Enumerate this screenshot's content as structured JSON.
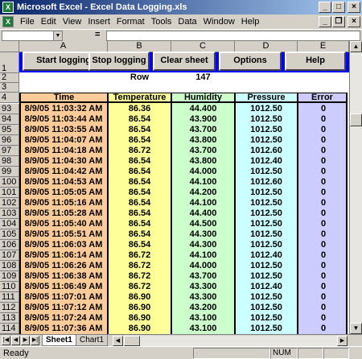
{
  "window": {
    "title": "Microsoft Excel - Excel Data Logging.xls",
    "app_icon": "X"
  },
  "menu": [
    "File",
    "Edit",
    "View",
    "Insert",
    "Format",
    "Tools",
    "Data",
    "Window",
    "Help"
  ],
  "formula_bar": {
    "name_box": "",
    "equals": "=",
    "value": ""
  },
  "columns": [
    "A",
    "B",
    "C",
    "D",
    "E"
  ],
  "buttons": {
    "start": "Start logging",
    "stop": "Stop logging",
    "clear": "Clear sheet",
    "options": "Options",
    "help": "Help"
  },
  "row2": {
    "label": "Row",
    "value": "147"
  },
  "headers": {
    "time": "Time",
    "temperature": "Temperature",
    "humidity": "Humidity",
    "pressure": "Pressure",
    "error": "Error"
  },
  "header_rows": [
    "1",
    "2",
    "3",
    "4"
  ],
  "colors": {
    "time": "#ffcc99",
    "temperature": "#ffff99",
    "humidity": "#ccffcc",
    "pressure": "#ccffff",
    "error": "#ccccff",
    "button_band": "#0000ff"
  },
  "rows": [
    {
      "r": "93",
      "time": "8/9/05 11:03:32 AM",
      "temp": "86.36",
      "hum": "44.400",
      "pres": "1012.50",
      "err": "0"
    },
    {
      "r": "94",
      "time": "8/9/05 11:03:44 AM",
      "temp": "86.54",
      "hum": "43.900",
      "pres": "1012.50",
      "err": "0"
    },
    {
      "r": "95",
      "time": "8/9/05 11:03:55 AM",
      "temp": "86.54",
      "hum": "43.700",
      "pres": "1012.50",
      "err": "0"
    },
    {
      "r": "96",
      "time": "8/9/05 11:04:07 AM",
      "temp": "86.54",
      "hum": "43.800",
      "pres": "1012.50",
      "err": "0"
    },
    {
      "r": "97",
      "time": "8/9/05 11:04:18 AM",
      "temp": "86.72",
      "hum": "43.700",
      "pres": "1012.60",
      "err": "0"
    },
    {
      "r": "98",
      "time": "8/9/05 11:04:30 AM",
      "temp": "86.54",
      "hum": "43.800",
      "pres": "1012.40",
      "err": "0"
    },
    {
      "r": "99",
      "time": "8/9/05 11:04:42 AM",
      "temp": "86.54",
      "hum": "44.000",
      "pres": "1012.50",
      "err": "0"
    },
    {
      "r": "100",
      "time": "8/9/05 11:04:53 AM",
      "temp": "86.54",
      "hum": "44.100",
      "pres": "1012.60",
      "err": "0"
    },
    {
      "r": "101",
      "time": "8/9/05 11:05:05 AM",
      "temp": "86.54",
      "hum": "44.200",
      "pres": "1012.50",
      "err": "0"
    },
    {
      "r": "102",
      "time": "8/9/05 11:05:16 AM",
      "temp": "86.54",
      "hum": "44.100",
      "pres": "1012.50",
      "err": "0"
    },
    {
      "r": "103",
      "time": "8/9/05 11:05:28 AM",
      "temp": "86.54",
      "hum": "44.400",
      "pres": "1012.50",
      "err": "0"
    },
    {
      "r": "104",
      "time": "8/9/05 11:05:40 AM",
      "temp": "86.54",
      "hum": "44.500",
      "pres": "1012.50",
      "err": "0"
    },
    {
      "r": "105",
      "time": "8/9/05 11:05:51 AM",
      "temp": "86.54",
      "hum": "44.300",
      "pres": "1012.50",
      "err": "0"
    },
    {
      "r": "106",
      "time": "8/9/05 11:06:03 AM",
      "temp": "86.54",
      "hum": "44.300",
      "pres": "1012.50",
      "err": "0"
    },
    {
      "r": "107",
      "time": "8/9/05 11:06:14 AM",
      "temp": "86.72",
      "hum": "44.100",
      "pres": "1012.40",
      "err": "0"
    },
    {
      "r": "108",
      "time": "8/9/05 11:06:26 AM",
      "temp": "86.72",
      "hum": "44.000",
      "pres": "1012.50",
      "err": "0"
    },
    {
      "r": "109",
      "time": "8/9/05 11:06:38 AM",
      "temp": "86.72",
      "hum": "43.700",
      "pres": "1012.50",
      "err": "0"
    },
    {
      "r": "110",
      "time": "8/9/05 11:06:49 AM",
      "temp": "86.72",
      "hum": "43.300",
      "pres": "1012.40",
      "err": "0"
    },
    {
      "r": "111",
      "time": "8/9/05 11:07:01 AM",
      "temp": "86.90",
      "hum": "43.300",
      "pres": "1012.50",
      "err": "0"
    },
    {
      "r": "112",
      "time": "8/9/05 11:07:12 AM",
      "temp": "86.90",
      "hum": "43.200",
      "pres": "1012.50",
      "err": "0"
    },
    {
      "r": "113",
      "time": "8/9/05 11:07:24 AM",
      "temp": "86.90",
      "hum": "43.100",
      "pres": "1012.50",
      "err": "0"
    },
    {
      "r": "114",
      "time": "8/9/05 11:07:36 AM",
      "temp": "86.90",
      "hum": "43.100",
      "pres": "1012.50",
      "err": "0"
    }
  ],
  "sheets": [
    "Sheet1",
    "Chart1"
  ],
  "status": {
    "text": "Ready",
    "num": "NUM"
  }
}
